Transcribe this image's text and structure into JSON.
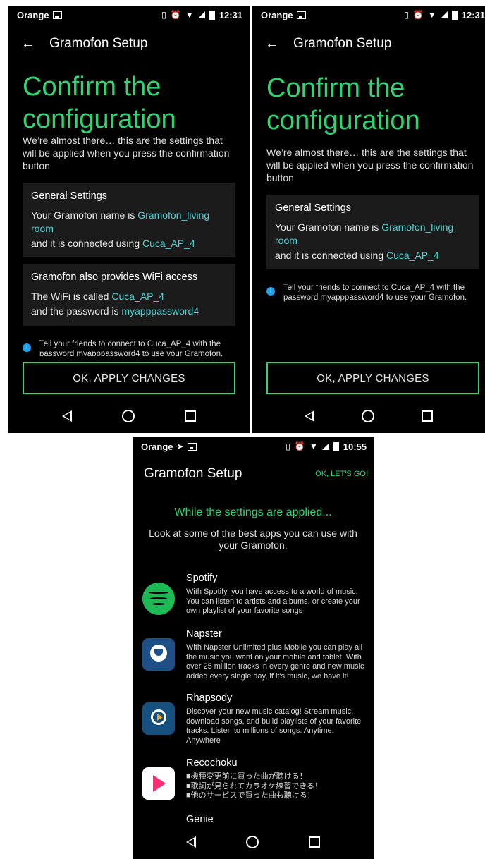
{
  "status": {
    "carrier": "Orange",
    "time1": "12:31",
    "time2": "12:31",
    "time3": "10:55"
  },
  "setup": {
    "app_title": "Gramofon Setup",
    "title_line1": "Confirm the",
    "title_line2": "configuration",
    "intro": "We’re almost there… this are the settings that will be applied when you press the confirmation button",
    "general_head": "General Settings",
    "name_prefix": "Your Gramofon name is ",
    "name_value": "Gramofon_living room",
    "connected_prefix": "and it is connected using ",
    "connected_value": "Cuca_AP_4",
    "wifi_head": "Gramofon also provides WiFi access",
    "wifi_prefix": "The WiFi is called ",
    "wifi_value": "Cuca_AP_4",
    "password_prefix": "and the password is ",
    "password_value": "myapppassword4",
    "tell_friends": "Tell your friends to connect to Cuca_AP_4 with the password myapppassword4 to use your Gramofon.",
    "apply_button": "OK, APPLY CHANGES"
  },
  "apps_screen": {
    "title": "Gramofon Setup",
    "lets_go": "OK, LET'S GO!",
    "applied": "While the settings are applied...",
    "look": "Look at some of the best apps you can use with your Gramofon.",
    "apps": [
      {
        "name": "Spotify",
        "desc": "With Spotify, you have access to a world of music. You can listen to artists and albums, or create your own playlist of your favorite songs"
      },
      {
        "name": "Napster",
        "desc": "With Napster Unlimited plus Mobile you can play all the music you want on your mobile and tablet. With over 25 million tracks in every genre and new music added every single day, if it's music, we have it!"
      },
      {
        "name": "Rhapsody",
        "desc": "Discover your new music catalog! Stream music, download songs, and build playlists of your favorite tracks. Listen to millions of songs. Anytime. Anywhere"
      },
      {
        "name": "Recochoku",
        "desc": "■機種変更前に買った曲が聴ける！\n■歌詞が見られてカラオケ練習できる！\n■他のサービスで買った曲も聴ける！"
      },
      {
        "name": "Genie",
        "desc": ""
      }
    ]
  },
  "icons": {
    "back": "arrow-left-icon",
    "info": "info-icon",
    "nav_back": "triangle-back-icon",
    "nav_home": "circle-home-icon",
    "nav_recent": "square-recent-icon"
  },
  "colors": {
    "accent_green": "#2ed573",
    "highlight_teal": "#4dd3d6",
    "info_blue": "#1da1f2"
  }
}
